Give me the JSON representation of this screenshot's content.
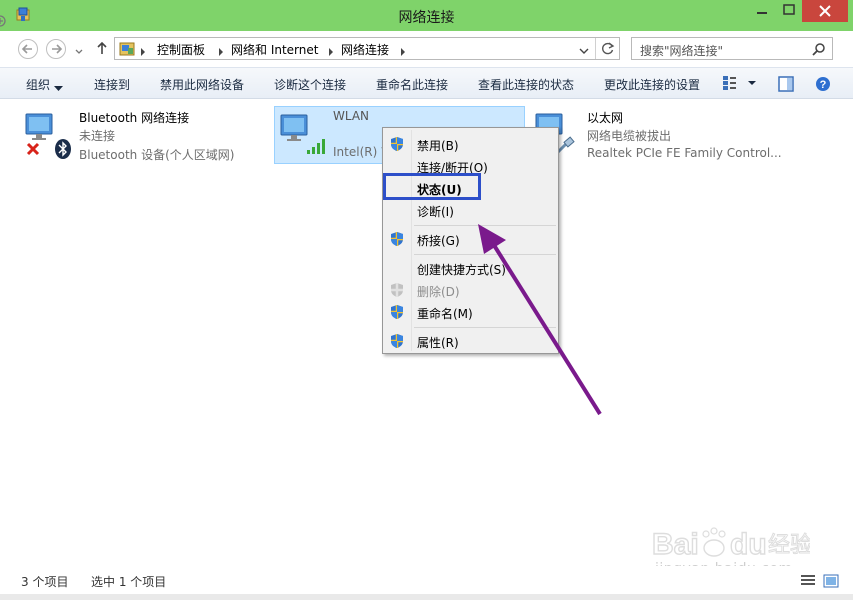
{
  "window": {
    "title": "网络连接"
  },
  "address_bar": {
    "breadcrumbs": [
      "控制面板",
      "网络和 Internet",
      "网络连接"
    ],
    "search_placeholder": "搜索\"网络连接\""
  },
  "command_bar": {
    "organize": "组织",
    "connect_to": "连接到",
    "disable_device": "禁用此网络设备",
    "diagnose": "诊断这个连接",
    "rename": "重命名此连接",
    "view_status": "查看此连接的状态",
    "change_settings": "更改此连接的设置"
  },
  "items": [
    {
      "name": "Bluetooth 网络连接",
      "status": "未连接",
      "device": "Bluetooth 设备(个人区域网)"
    },
    {
      "name": "WLAN",
      "device": "Intel(R) W"
    },
    {
      "name": "以太网",
      "status": "网络电缆被拔出",
      "device": "Realtek PCIe FE Family Control..."
    }
  ],
  "context_menu": {
    "items": [
      {
        "label": "禁用(B)",
        "shield": true,
        "disabled": false
      },
      {
        "label": "连接/断开(O)",
        "shield": false,
        "disabled": false
      },
      {
        "label": "状态(U)",
        "shield": false,
        "disabled": false,
        "bold": true
      },
      {
        "label": "诊断(I)",
        "shield": false,
        "disabled": false
      },
      {
        "label": "桥接(G)",
        "shield": true,
        "disabled": false
      },
      {
        "label": "创建快捷方式(S)",
        "shield": false,
        "disabled": false
      },
      {
        "label": "删除(D)",
        "shield": true,
        "disabled": true
      },
      {
        "label": "重命名(M)",
        "shield": true,
        "disabled": false
      },
      {
        "label": "属性(R)",
        "shield": true,
        "disabled": false
      }
    ]
  },
  "status_bar": {
    "count": "3 个项目",
    "selected": "选中 1 个项目"
  },
  "watermark": {
    "brand": "Baidu经验",
    "url": "jingyan.baidu.com"
  },
  "colors": {
    "titlebar": "#7fd36a",
    "close_button": "#c9463d",
    "selection": "#cce8ff",
    "highlight_box": "#2d4fc9",
    "annotation_arrow": "#7a1a8c"
  },
  "icons": {
    "app": "network-folder-icon",
    "shield": "uac-shield-icon",
    "bluetooth": "bluetooth-icon",
    "signal": "wifi-signal-icon",
    "error": "red-x-icon"
  }
}
